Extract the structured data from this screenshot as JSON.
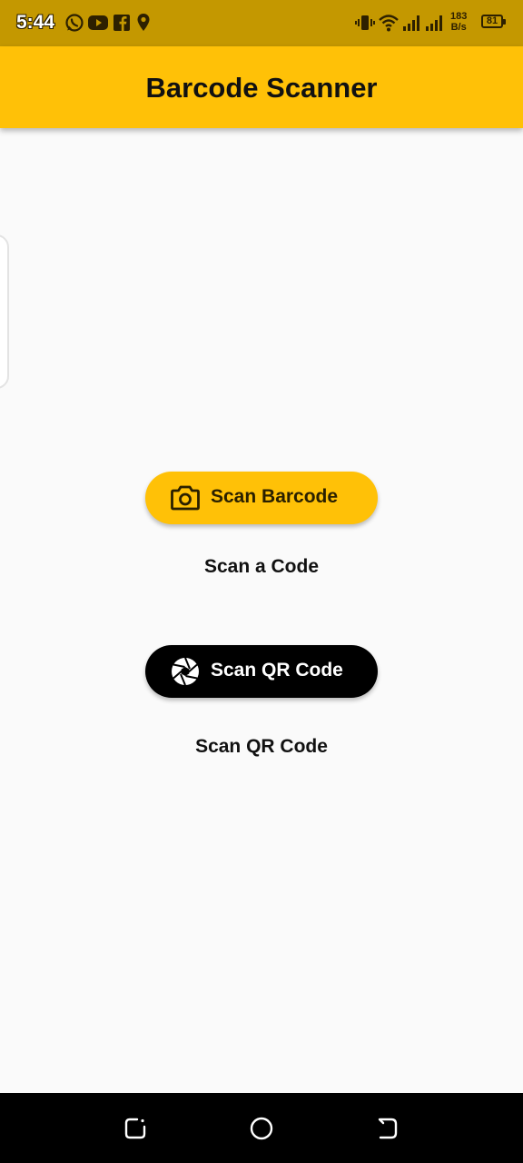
{
  "status_bar": {
    "time": "5:44",
    "net_speed_value": "183",
    "net_speed_unit": "B/s",
    "battery_level": "81",
    "notification_icons": [
      "whatsapp-icon",
      "youtube-icon",
      "facebook-icon",
      "location-icon"
    ],
    "system_icons": [
      "vibrate-icon",
      "wifi-icon",
      "signal-icon",
      "signal-icon"
    ]
  },
  "app_bar": {
    "title": "Barcode Scanner",
    "color": "#ffc107"
  },
  "main": {
    "barcode_button": {
      "label": "Scan Barcode",
      "icon": "camera-icon",
      "color": "#ffc107"
    },
    "barcode_result": "Scan a Code",
    "qr_button": {
      "label": "Scan QR Code",
      "icon": "camera-shutter-icon",
      "color": "#000000"
    },
    "qr_result": "Scan QR Code"
  },
  "nav_bar": {
    "buttons": [
      "recents-icon",
      "home-icon",
      "back-icon"
    ]
  }
}
